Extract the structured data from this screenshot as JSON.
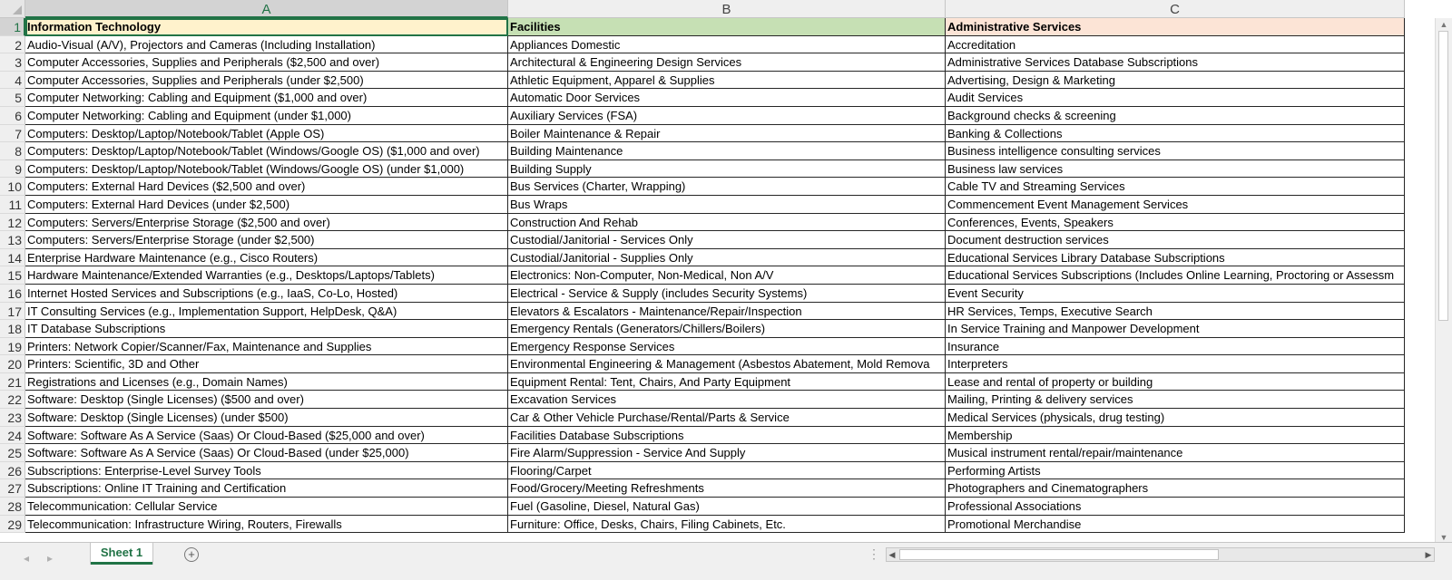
{
  "columns": [
    "A",
    "B",
    "C"
  ],
  "headers": {
    "row": 1,
    "A": "Information Technology",
    "B": "Facilities",
    "C": "Administrative Services"
  },
  "rows": [
    {
      "n": 2,
      "A": "Audio-Visual (A/V), Projectors and Cameras (Including Installation)",
      "B": "Appliances Domestic",
      "C": "Accreditation"
    },
    {
      "n": 3,
      "A": "Computer Accessories, Supplies and Peripherals ($2,500 and over)",
      "B": "Architectural & Engineering Design Services",
      "C": "Administrative Services Database Subscriptions"
    },
    {
      "n": 4,
      "A": "Computer Accessories, Supplies and Peripherals (under $2,500)",
      "B": "Athletic Equipment, Apparel & Supplies",
      "C": "Advertising, Design & Marketing"
    },
    {
      "n": 5,
      "A": "Computer Networking: Cabling and Equipment ($1,000 and over)",
      "B": "Automatic Door Services",
      "C": "Audit Services"
    },
    {
      "n": 6,
      "A": "Computer Networking: Cabling and Equipment (under $1,000)",
      "B": "Auxiliary Services (FSA)",
      "C": "Background checks & screening"
    },
    {
      "n": 7,
      "A": "Computers: Desktop/Laptop/Notebook/Tablet (Apple OS)",
      "B": "Boiler Maintenance & Repair",
      "C": "Banking & Collections"
    },
    {
      "n": 8,
      "A": "Computers: Desktop/Laptop/Notebook/Tablet (Windows/Google OS) ($1,000 and over)",
      "B": "Building Maintenance",
      "C": "Business intelligence consulting services"
    },
    {
      "n": 9,
      "A": "Computers: Desktop/Laptop/Notebook/Tablet (Windows/Google OS) (under $1,000)",
      "B": "Building Supply",
      "C": "Business law services"
    },
    {
      "n": 10,
      "A": "Computers: External Hard Devices ($2,500 and over)",
      "B": "Bus Services (Charter, Wrapping)",
      "C": "Cable TV and Streaming Services"
    },
    {
      "n": 11,
      "A": "Computers: External Hard Devices (under $2,500)",
      "B": "Bus Wraps",
      "C": "Commencement Event Management Services"
    },
    {
      "n": 12,
      "A": "Computers: Servers/Enterprise Storage ($2,500 and over)",
      "B": "Construction And Rehab",
      "C": "Conferences, Events, Speakers"
    },
    {
      "n": 13,
      "A": "Computers: Servers/Enterprise Storage (under $2,500)",
      "B": "Custodial/Janitorial - Services Only",
      "C": "Document destruction services"
    },
    {
      "n": 14,
      "A": "Enterprise Hardware Maintenance (e.g., Cisco Routers)",
      "B": "Custodial/Janitorial - Supplies Only",
      "C": "Educational Services Library Database Subscriptions"
    },
    {
      "n": 15,
      "A": "Hardware Maintenance/Extended Warranties (e.g., Desktops/Laptops/Tablets)",
      "B": "Electronics: Non-Computer, Non-Medical, Non A/V",
      "C": "Educational Services Subscriptions (Includes Online Learning, Proctoring or Assessm"
    },
    {
      "n": 16,
      "A": "Internet Hosted Services and Subscriptions (e.g., IaaS, Co-Lo, Hosted)",
      "B": "Electrical - Service & Supply (includes Security Systems)",
      "C": "Event Security"
    },
    {
      "n": 17,
      "A": "IT Consulting Services (e.g., Implementation Support, HelpDesk, Q&A)",
      "B": "Elevators & Escalators - Maintenance/Repair/Inspection",
      "C": "HR Services, Temps, Executive Search"
    },
    {
      "n": 18,
      "A": "IT Database Subscriptions",
      "B": "Emergency Rentals (Generators/Chillers/Boilers)",
      "C": "In Service Training and Manpower Development"
    },
    {
      "n": 19,
      "A": "Printers: Network Copier/Scanner/Fax, Maintenance and Supplies",
      "B": "Emergency Response Services",
      "C": "Insurance"
    },
    {
      "n": 20,
      "A": "Printers: Scientific, 3D and Other",
      "B": "Environmental Engineering & Management (Asbestos Abatement, Mold Remova",
      "C": "Interpreters"
    },
    {
      "n": 21,
      "A": "Registrations and Licenses (e.g., Domain Names)",
      "B": "Equipment Rental: Tent, Chairs, And Party Equipment",
      "C": "Lease and rental of property or building"
    },
    {
      "n": 22,
      "A": "Software: Desktop (Single Licenses) ($500 and over)",
      "B": "Excavation Services",
      "C": "Mailing, Printing & delivery services"
    },
    {
      "n": 23,
      "A": "Software: Desktop (Single Licenses) (under $500)",
      "B": "Car & Other Vehicle Purchase/Rental/Parts & Service",
      "C": "Medical Services (physicals, drug testing)"
    },
    {
      "n": 24,
      "A": "Software: Software As A Service (Saas) Or Cloud-Based ($25,000 and over)",
      "B": "Facilities Database Subscriptions",
      "C": "Membership"
    },
    {
      "n": 25,
      "A": "Software: Software As A Service (Saas) Or Cloud-Based (under $25,000)",
      "B": "Fire Alarm/Suppression - Service And Supply",
      "C": "Musical instrument rental/repair/maintenance"
    },
    {
      "n": 26,
      "A": "Subscriptions: Enterprise-Level Survey Tools",
      "B": "Flooring/Carpet",
      "C": "Performing Artists"
    },
    {
      "n": 27,
      "A": "Subscriptions: Online IT Training and Certification",
      "B": "Food/Grocery/Meeting Refreshments",
      "C": "Photographers and Cinematographers"
    },
    {
      "n": 28,
      "A": "Telecommunication: Cellular Service",
      "B": "Fuel (Gasoline, Diesel, Natural Gas)",
      "C": "Professional Associations"
    },
    {
      "n": 29,
      "A": "Telecommunication: Infrastructure Wiring, Routers, Firewalls",
      "B": "Furniture: Office, Desks, Chairs, Filing Cabinets, Etc.",
      "C": "Promotional Merchandise"
    }
  ],
  "sheet_tab": "Sheet 1",
  "icons": {
    "add_sheet": "plus-circle-icon",
    "prev_sheet": "chevron-left-icon",
    "next_sheet": "chevron-right-icon",
    "scroll_left": "triangle-left-icon",
    "scroll_right": "triangle-right-icon",
    "scroll_up": "triangle-up-icon",
    "scroll_down": "triangle-down-icon",
    "select_all": "select-all-corner-icon"
  },
  "colors": {
    "accent": "#217346",
    "header_A_fill": "#fff2cc",
    "header_B_fill": "#c6e0b4",
    "header_C_fill": "#fce4d6"
  }
}
